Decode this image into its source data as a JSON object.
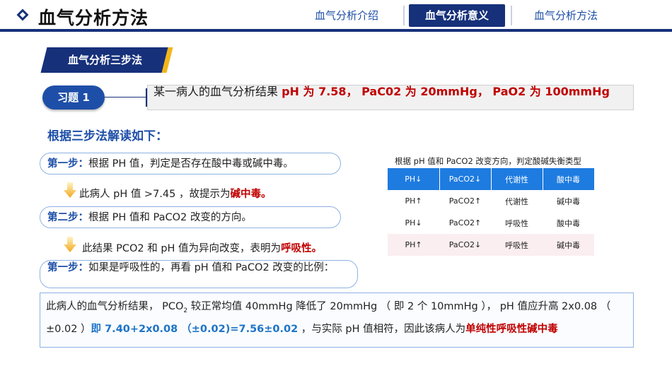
{
  "header": {
    "title": "血气分析方法",
    "tabs": [
      {
        "label": "血气分析介绍"
      },
      {
        "label": "血气分析意义"
      },
      {
        "label": "血气分析方法"
      }
    ]
  },
  "section": {
    "title": "血气分析三步法"
  },
  "exercise": {
    "label": "习题 1",
    "prefix": "某一病人的血气分析结果 ",
    "values": "pH 为 7.58， PaC02 为 20mmHg， PaO2 为 100mmHg"
  },
  "interpretation_heading": "根据三步法解读如下：",
  "steps": [
    {
      "label": "第一步：",
      "text": "根据 PH 值，判定是否存在酸中毒或碱中毒。",
      "result_prefix": "此病人 pH 值 >7.45 ，故提示为",
      "result_highlight": "碱中毒。"
    },
    {
      "label": "第二步：",
      "text": "根据 PH 值和 PaCO2 改变的方向。",
      "result_prefix": "此结果 PCO2 和 pH 值为异向改变，表明为",
      "result_highlight": "呼吸性。"
    },
    {
      "label": "第一步：",
      "text": "如果是呼吸性的，再看 pH 值和 PaCO2 改变的比例："
    }
  ],
  "table": {
    "caption": "根据 pH 值和 PaCO2 改变方向，判定酸碱失衡类型",
    "header": [
      "PH↓",
      "PaCO2↓",
      "代谢性",
      "酸中毒"
    ],
    "rows": [
      [
        "PH↑",
        "PaCO2↑",
        "代谢性",
        "碱中毒"
      ],
      [
        "PH↓",
        "PaCO2↑",
        "呼吸性",
        "酸中毒"
      ],
      [
        "PH↑",
        "PaCO2↓",
        "呼吸性",
        "碱中毒"
      ]
    ]
  },
  "conclusion": {
    "part1": "此病人的血气分析结果， PCO",
    "sub": "2",
    "part2": " 较正常均值 40mmHg 降低了 20mmHg （ 即 2 个 10mmHg ）， pH 值应升高 2x0.08 （ ±0.02 ）",
    "highlight_blue": "即 7.40+2x0.08 （±0.02)=7.56±0.02",
    "part3": " ，与实际 pH 值相符，因此该病人为",
    "highlight_red": "单纯性呼吸性碱中毒"
  },
  "colors": {
    "navy": "#16307a",
    "blue": "#1e4fa8",
    "table_header": "#1e7be0",
    "red": "#c00000",
    "gold": "#f2b51b"
  }
}
